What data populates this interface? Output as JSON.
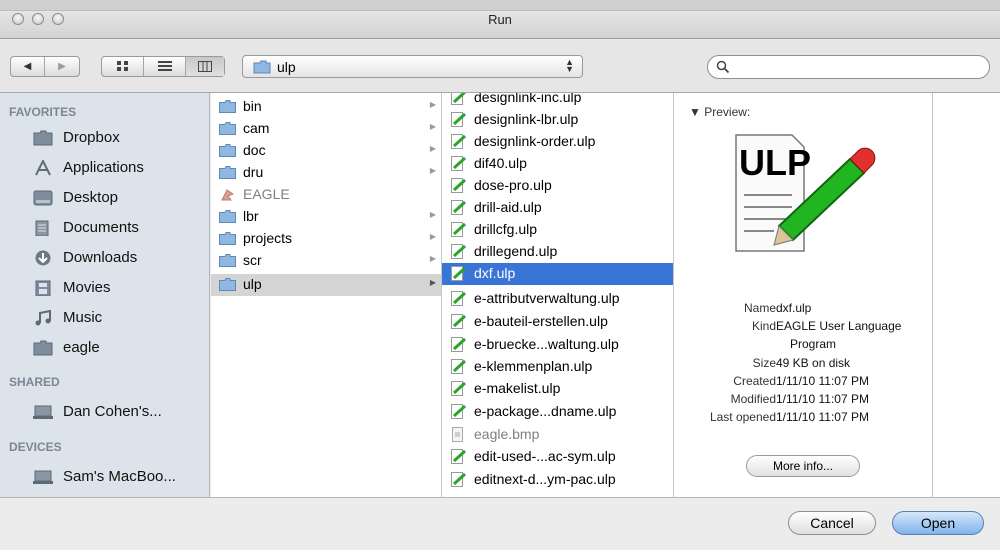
{
  "window": {
    "title": "Run"
  },
  "toolbar": {
    "back_icon": "back-arrow",
    "forward_icon": "forward-arrow",
    "view_modes": [
      "icon-view",
      "list-view",
      "column-view"
    ],
    "active_view": "column-view",
    "path_popup": {
      "value": "ulp",
      "icon": "folder-icon"
    },
    "search": {
      "value": "",
      "placeholder": ""
    }
  },
  "sidebar": {
    "sections": [
      {
        "heading": "FAVORITES",
        "items": [
          {
            "label": "Dropbox",
            "icon": "folder-icon"
          },
          {
            "label": "Applications",
            "icon": "applications-icon"
          },
          {
            "label": "Desktop",
            "icon": "desktop-icon"
          },
          {
            "label": "Documents",
            "icon": "documents-icon"
          },
          {
            "label": "Downloads",
            "icon": "downloads-icon"
          },
          {
            "label": "Movies",
            "icon": "movies-icon"
          },
          {
            "label": "Music",
            "icon": "music-icon"
          },
          {
            "label": "eagle",
            "icon": "folder-icon"
          }
        ]
      },
      {
        "heading": "SHARED",
        "items": [
          {
            "label": "Dan Cohen's...",
            "icon": "shared-computer-icon"
          }
        ]
      },
      {
        "heading": "DEVICES",
        "items": [
          {
            "label": "Sam's MacBoo...",
            "icon": "laptop-icon"
          }
        ]
      }
    ]
  },
  "column1": [
    {
      "label": "bin",
      "type": "folder",
      "has_children": true
    },
    {
      "label": "cam",
      "type": "folder",
      "has_children": true
    },
    {
      "label": "doc",
      "type": "folder",
      "has_children": true
    },
    {
      "label": "dru",
      "type": "folder",
      "has_children": true
    },
    {
      "label": "EAGLE",
      "type": "app",
      "has_children": false,
      "dim": true
    },
    {
      "label": "lbr",
      "type": "folder",
      "has_children": true
    },
    {
      "label": "projects",
      "type": "folder",
      "has_children": true
    },
    {
      "label": "scr",
      "type": "folder",
      "has_children": true
    },
    {
      "label": "ulp",
      "type": "folder",
      "has_children": true,
      "selected": true
    }
  ],
  "column2": [
    {
      "label": "designlink-inc.ulp",
      "type": "ulp"
    },
    {
      "label": "designlink-lbr.ulp",
      "type": "ulp"
    },
    {
      "label": "designlink-order.ulp",
      "type": "ulp"
    },
    {
      "label": "dif40.ulp",
      "type": "ulp"
    },
    {
      "label": "dose-pro.ulp",
      "type": "ulp"
    },
    {
      "label": "drill-aid.ulp",
      "type": "ulp"
    },
    {
      "label": "drillcfg.ulp",
      "type": "ulp"
    },
    {
      "label": "drillegend.ulp",
      "type": "ulp"
    },
    {
      "label": "dxf.ulp",
      "type": "ulp",
      "selected": true
    },
    {
      "label": "e-attributverwaltung.ulp",
      "type": "ulp"
    },
    {
      "label": "e-bauteil-erstellen.ulp",
      "type": "ulp"
    },
    {
      "label": "e-bruecke...waltung.ulp",
      "type": "ulp"
    },
    {
      "label": "e-klemmenplan.ulp",
      "type": "ulp"
    },
    {
      "label": "e-makelist.ulp",
      "type": "ulp"
    },
    {
      "label": "e-package...dname.ulp",
      "type": "ulp"
    },
    {
      "label": "eagle.bmp",
      "type": "bmp",
      "dim": true
    },
    {
      "label": "edit-used-...ac-sym.ulp",
      "type": "ulp"
    },
    {
      "label": "editnext-d...ym-pac.ulp",
      "type": "ulp"
    }
  ],
  "preview": {
    "heading": "Preview:",
    "icon_text": "ULP",
    "name_label": "Name",
    "name": "dxf.ulp",
    "kind_label": "Kind",
    "kind_line1": "EAGLE User Language",
    "kind_line2": "Program",
    "size_label": "Size",
    "size": "49 KB on disk",
    "created_label": "Created",
    "created": "1/11/10 11:07 PM",
    "modified_label": "Modified",
    "modified": "1/11/10 11:07 PM",
    "opened_label": "Last opened",
    "opened": "1/11/10 11:07 PM",
    "more_info": "More info..."
  },
  "buttons": {
    "cancel": "Cancel",
    "open": "Open"
  },
  "colors": {
    "selection": "#3875d7",
    "sidebar_bg": "#dde3ea",
    "folder": "#8fb7e0"
  }
}
